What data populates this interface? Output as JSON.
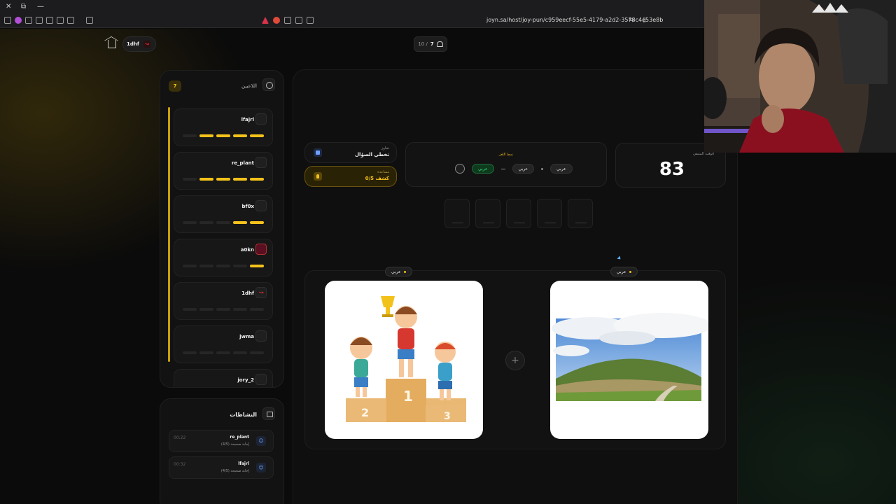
{
  "browser": {
    "url": "joyn.sa/host/joy-pun/c959eecf-55e5-4179-a2d2-3578c4e53e8b"
  },
  "topbar": {
    "user_name": "1dhf",
    "player_count_current": "7",
    "player_count_total": "10 /"
  },
  "players_panel": {
    "title": "اللاعبين",
    "count": "7",
    "players": [
      {
        "name": "lfajrl",
        "progress_filled": 4,
        "progress_total": 5
      },
      {
        "name": "re_plant",
        "progress_filled": 4,
        "progress_total": 5
      },
      {
        "name": "bf0x",
        "progress_filled": 2,
        "progress_total": 5
      },
      {
        "name": "a0kn",
        "progress_filled": 1,
        "progress_total": 5
      },
      {
        "name": "1dhf",
        "progress_filled": 0,
        "progress_total": 5
      },
      {
        "name": "jwma",
        "progress_filled": 0,
        "progress_total": 5
      },
      {
        "name": "jory_2",
        "progress_filled": 0,
        "progress_total": 5
      }
    ]
  },
  "activities": {
    "title": "النشاطات",
    "items": [
      {
        "time": "00:22",
        "user": "re_plant",
        "detail": "إجابة صحيحة (4/5)"
      },
      {
        "time": "00:32",
        "user": "lfajrl",
        "detail": "إجابة صحيحة (4/5)"
      }
    ]
  },
  "timer": {
    "label": "الوقت المتبقي",
    "value": "83"
  },
  "mode": {
    "label": "نمط اللغز",
    "tags": [
      "عربي",
      "عربي",
      "عربي"
    ]
  },
  "skip": {
    "sub": "تجاوز",
    "label": "تخطي السؤال"
  },
  "hint": {
    "sub": "مساعدة",
    "label": "0/5 كشف"
  },
  "answer_slots": 5,
  "images": [
    {
      "tag": "عربي",
      "depicts": "children on winners podium with trophy"
    },
    {
      "tag": "عربي",
      "depicts": "green hill under cloudy sky"
    }
  ],
  "colors": {
    "accent_gold": "#f4c21a",
    "accent_green": "#3ee07a",
    "background": "#0b0b0b"
  }
}
